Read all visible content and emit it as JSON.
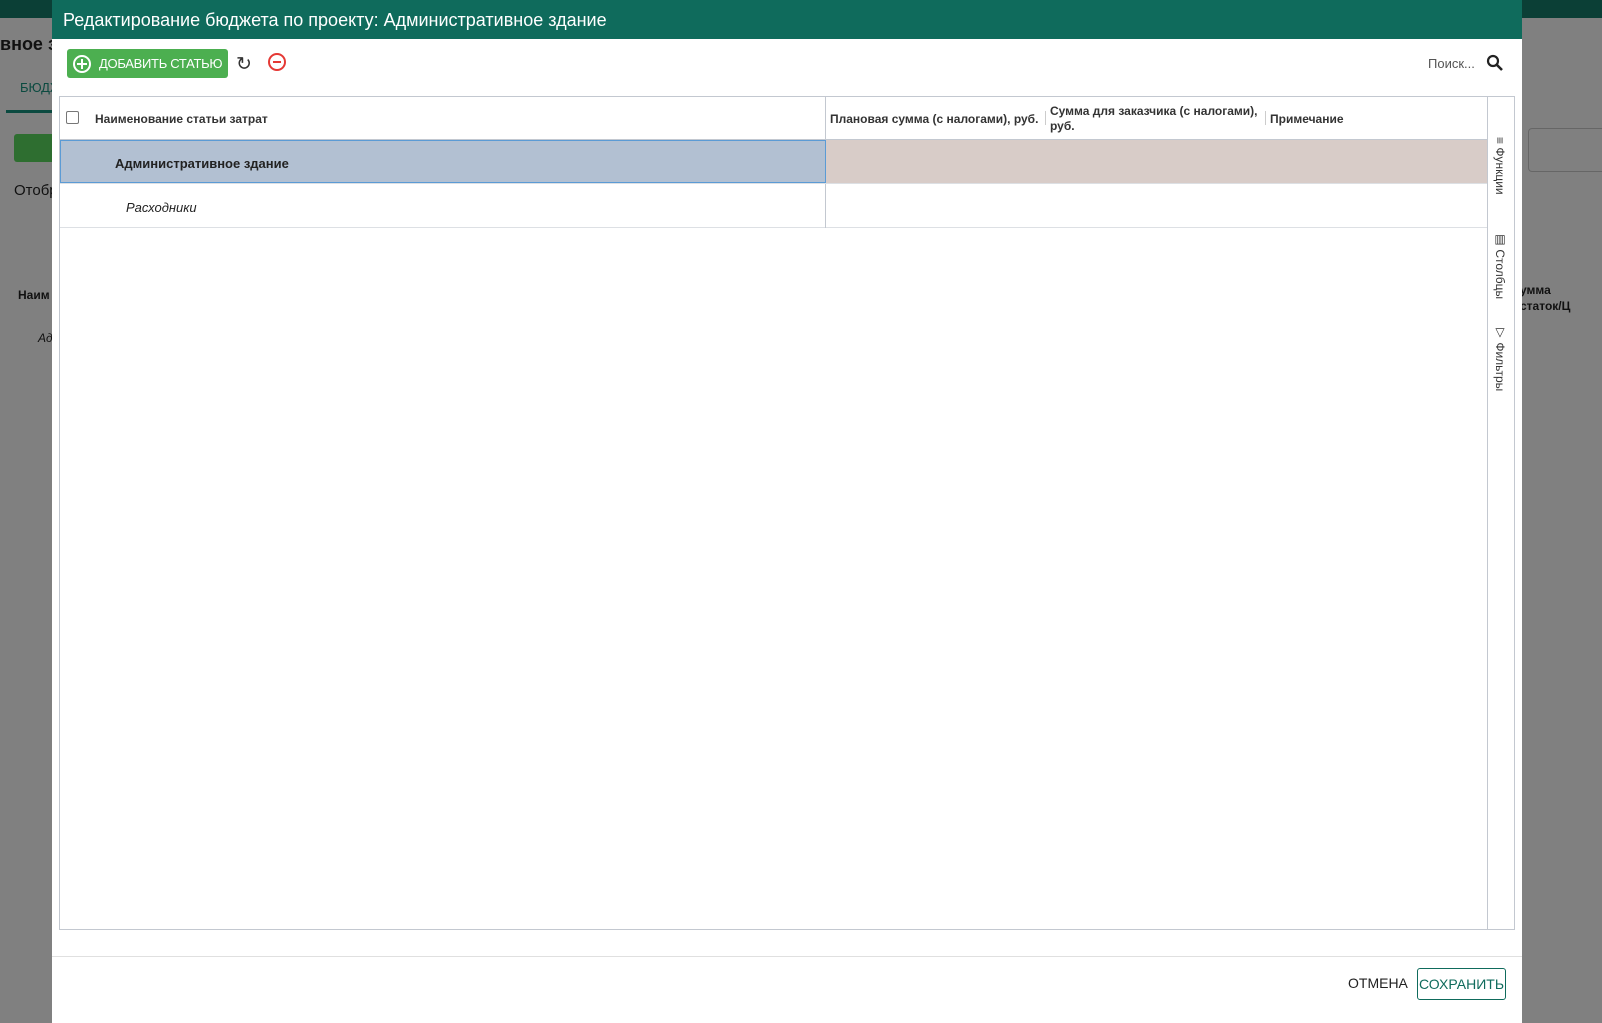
{
  "background": {
    "title": "вное з",
    "tab": "БЮДЖ",
    "show": "Отобр",
    "col_name": "Наим",
    "row": "Ад",
    "right_col": "умма\nстаток/Ц"
  },
  "modal": {
    "title": "Редактирование бюджета по проекту: Административное здание"
  },
  "toolbar": {
    "add_label": "ДОБАВИТЬ СТАТЬЮ",
    "search_placeholder": "Поиск..."
  },
  "grid": {
    "columns": [
      "Наименование статьи затрат",
      "Плановая сумма (с налогами), руб.",
      "Сумма для заказчика (с налогами), руб.",
      "Примечание"
    ],
    "rows": [
      {
        "name": "Административное здание",
        "level": 0
      },
      {
        "name": "Расходники",
        "level": 1
      }
    ],
    "side_tabs": [
      "Функции",
      "Столбцы",
      "Фильтры"
    ]
  },
  "footer": {
    "cancel": "ОТМЕНА",
    "save": "СОХРАНИТЬ"
  }
}
